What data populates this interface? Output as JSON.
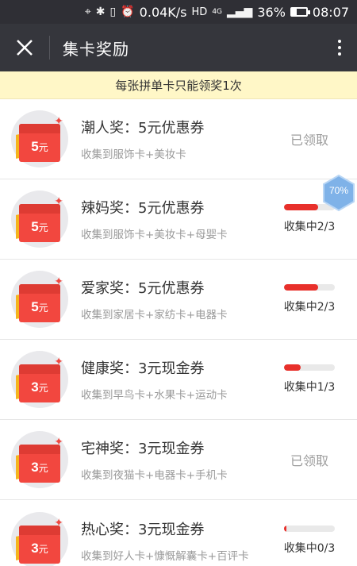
{
  "status_bar": {
    "speed": "0.04K/s",
    "network": "HD",
    "signal_label": "4G",
    "battery": "36%",
    "battery_level": 0.36,
    "time": "08:07"
  },
  "header": {
    "title": "集卡奖励"
  },
  "notice": "每张拼单卡只能领奖1次",
  "rewards": [
    {
      "title": "潮人奖：5元优惠券",
      "desc": "收集到服饰卡+美妆卡",
      "amount": "5",
      "unit": "元",
      "claimed": true,
      "status_text": "已领取"
    },
    {
      "title": "辣妈奖：5元优惠券",
      "desc": "收集到服饰卡+美妆卡+母婴卡",
      "amount": "5",
      "unit": "元",
      "claimed": false,
      "status_text": "收集中2/3",
      "progress": 0.667
    },
    {
      "title": "爱家奖：5元优惠券",
      "desc": "收集到家居卡+家纺卡+电器卡",
      "amount": "5",
      "unit": "元",
      "claimed": false,
      "status_text": "收集中2/3",
      "progress": 0.667
    },
    {
      "title": "健康奖：3元现金券",
      "desc": "收集到早鸟卡+水果卡+运动卡",
      "amount": "3",
      "unit": "元",
      "claimed": false,
      "status_text": "收集中1/3",
      "progress": 0.333
    },
    {
      "title": "宅神奖：3元现金券",
      "desc": "收集到夜猫卡+电器卡+手机卡",
      "amount": "3",
      "unit": "元",
      "claimed": true,
      "status_text": "已领取"
    },
    {
      "title": "热心奖：3元现金券",
      "desc": "收集到好人卡+慷慨解囊卡+百评卡",
      "amount": "3",
      "unit": "元",
      "claimed": false,
      "status_text": "收集中0/3",
      "progress": 0.05
    }
  ],
  "float_badge": {
    "text": "70%",
    "color": "#7fb2e8"
  },
  "colors": {
    "header_bg": "#35363c",
    "notice_bg": "#fff7c7",
    "accent_red": "#e8302b"
  }
}
